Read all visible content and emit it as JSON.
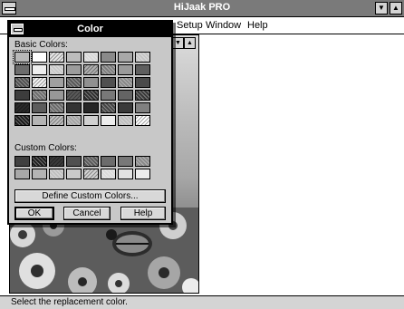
{
  "app": {
    "title": "HiJaak PRO",
    "menu": [
      {
        "label": "Setup",
        "underline": "S"
      },
      {
        "label": "Window",
        "underline": "W"
      },
      {
        "label": "Help",
        "underline": "H"
      }
    ],
    "status": "Select the replacement color."
  },
  "dialog": {
    "title": "Color",
    "basic_label": "Basic Colors:",
    "custom_label": "Custom Colors:",
    "define_button": "Define Custom Colors...",
    "ok_button": "OK",
    "cancel_button": "Cancel",
    "help_button": "Help",
    "basic_colors": [
      "#b8b8b8",
      "#ffffff",
      "#e6e6e6",
      "#bcbcbc",
      "#d8d8d8",
      "#8a8a8a",
      "#a8a8a8",
      "#c4c4c4",
      "#6c6c6c",
      "#eeeeee",
      "#c8c8c8",
      "#9c9c9c",
      "#b0b0b0",
      "#7c7c7c",
      "#9a9a9a",
      "#5e5e5e",
      "#4e4e4e",
      "#f2f2f2",
      "#a0a0a0",
      "#585858",
      "#909090",
      "#505050",
      "#888888",
      "#4a4a4a",
      "#3c3c3c",
      "#6e6e6e",
      "#989898",
      "#5a5a5a",
      "#2e2e2e",
      "#787878",
      "#646464",
      "#383838",
      "#2a2a2a",
      "#5c5c5c",
      "#6a6a6a",
      "#343434",
      "#262626",
      "#444444",
      "#3a3a3a",
      "#808080",
      "#1a1a1a",
      "#b4b4b4",
      "#c0c0c0",
      "#a4a4a4",
      "#d0d0d0",
      "#ececec",
      "#bebebe",
      "#ffffff"
    ],
    "custom_colors": [
      "#404040",
      "#1e1e1e",
      "#3a3a3a",
      "#505050",
      "#5a5a5a",
      "#6c6c6c",
      "#787878",
      "#8a8a8a",
      "#a8a8a8",
      "#b4b4b4",
      "#c0c0c0",
      "#cacaca",
      "#d2d2d2",
      "#dadada",
      "#e2e2e2",
      "#ececec"
    ]
  }
}
